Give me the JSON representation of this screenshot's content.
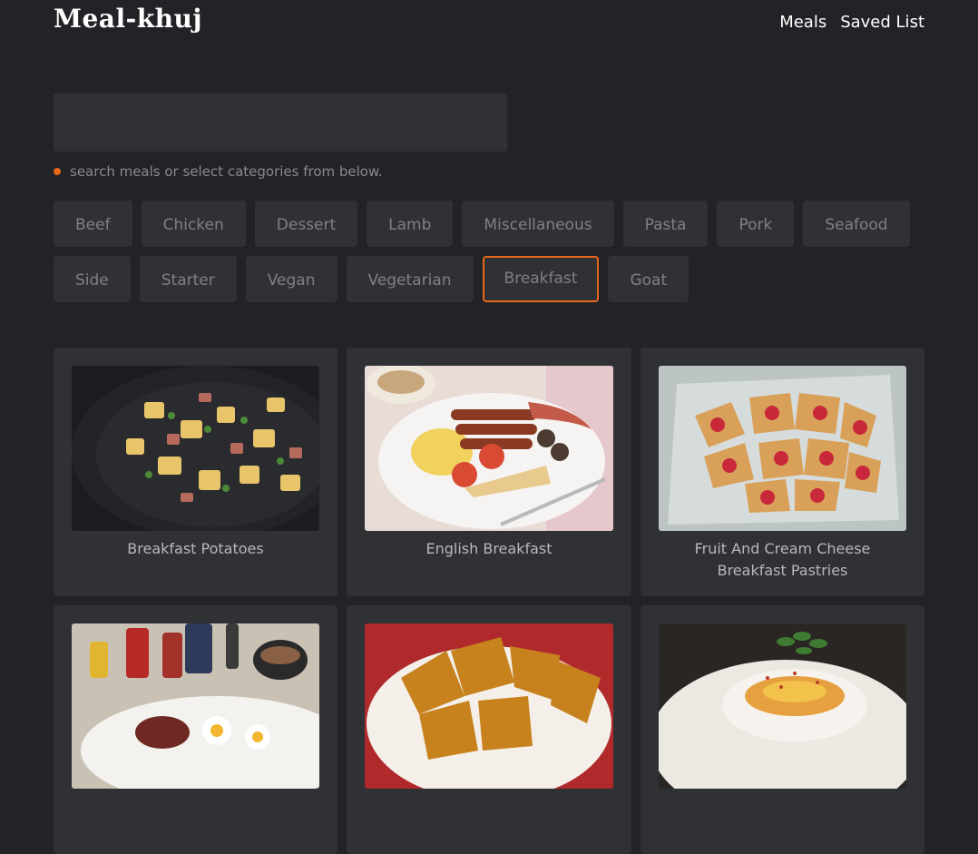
{
  "app": {
    "logo": "Meal-khuj"
  },
  "nav": {
    "meals": "Meals",
    "saved": "Saved List"
  },
  "search": {
    "value": "",
    "placeholder": ""
  },
  "hint": "search meals or select categories from below.",
  "categories": {
    "row1": [
      "Beef",
      "Chicken",
      "Dessert",
      "Lamb",
      "Miscellaneous",
      "Pasta",
      "Pork",
      "Seafood"
    ],
    "row2": [
      "Side",
      "Starter",
      "Vegan",
      "Vegetarian",
      "Breakfast",
      "Goat"
    ],
    "active": "Breakfast"
  },
  "meals": [
    {
      "name": "Breakfast Potatoes"
    },
    {
      "name": "English Breakfast"
    },
    {
      "name": "Fruit And Cream Cheese Breakfast Pastries"
    },
    {
      "name": ""
    },
    {
      "name": ""
    },
    {
      "name": ""
    }
  ],
  "colors": {
    "background": "#222327",
    "surface": "#303135",
    "accent": "#e8661c"
  }
}
